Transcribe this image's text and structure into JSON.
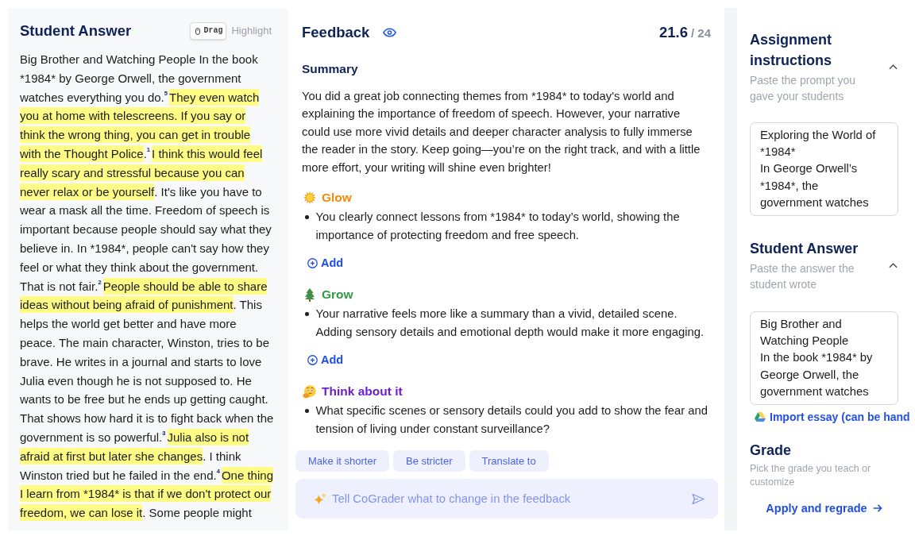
{
  "student_answer": {
    "title": "Student Answer",
    "tools": [
      {
        "label": "Drag",
        "selected": true
      },
      {
        "label": "Highlight",
        "selected": false
      }
    ],
    "segments": [
      {
        "kind": "plain",
        "text": "Big Brother and Watching People In the book *1984* by George Orwell, the government watches everything you do. "
      },
      {
        "kind": "highlight",
        "marker": "5",
        "text": "They even watch you at home with telescreens. If you say or think the wrong thing, you can get in trouble with the Thought Police"
      },
      {
        "kind": "plain",
        "text": ". "
      },
      {
        "kind": "highlight",
        "marker": "1",
        "text": "I think this would feel really scary and stressful because you can never relax or be yourself"
      },
      {
        "kind": "plain",
        "text": ". It's like you have to wear a mask all the time. Freedom of speech is important because people should say what they believe in. In *1984*, people can't say how they feel or what they think about the government. That is not fair. "
      },
      {
        "kind": "highlight",
        "marker": "2",
        "text": "People should be able to share ideas without being afraid of punishment"
      },
      {
        "kind": "plain",
        "text": ". This helps the world get better and have more peace. The main character, Winston, tries to be brave. He writes in a journal and starts to love Julia even though he is not supposed to. He wants to be free but he ends up getting caught. That shows how hard it is to fight back when the government is so powerful. "
      },
      {
        "kind": "highlight",
        "marker": "3",
        "text": "Julia also is not afraid at first but later she changes"
      },
      {
        "kind": "plain",
        "text": ". I think Winston tried but he failed in the end. "
      },
      {
        "kind": "highlight",
        "marker": "4",
        "text": "One thing I learn from *1984* is that if we don't protect our freedom, we can lose it"
      },
      {
        "kind": "plain",
        "text": ". Some people might"
      }
    ]
  },
  "feedback": {
    "title": "Feedback",
    "score": "21.6",
    "max_score": "/ 24",
    "summary": {
      "title": "Summary",
      "text": "You did a great job connecting themes from *1984* to today's world and explaining the importance of freedom of speech. However, your narrative could use more vivid details and deeper character analysis to fully immerse the reader in the story. Keep going—you’re on the right track, and with a little more effort, your writing will shine even brighter!"
    },
    "sections": [
      {
        "kind": "glow",
        "title": "Glow",
        "items": [
          "You clearly connect lessons from *1984* to today’s world, showing the importance of protecting freedom and free speech."
        ],
        "add_label": "Add"
      },
      {
        "kind": "grow",
        "title": "Grow",
        "items": [
          "Your narrative feels more like a summary than a vivid, detailed scene. Adding sensory details and emotional depth would make it more engaging."
        ],
        "add_label": "Add"
      },
      {
        "kind": "think",
        "title": "Think about it",
        "items": [
          "What specific scenes or sensory details could you add to show the fear and tension of living under constant surveillance?"
        ]
      }
    ],
    "suggestions": [
      "Make it shorter",
      "Be stricter",
      "Translate to"
    ],
    "prompt": {
      "placeholder": "Tell CoGrader what to change in the feedback"
    }
  },
  "inputs": [
    {
      "title": "Assignment instructions",
      "hint": "Paste the prompt you gave your students",
      "expanded": true,
      "value": "Exploring the World of *1984*\nIn George Orwell’s *1984*, the government watches"
    },
    {
      "title": "Student Answer",
      "hint": "Paste the answer the student wrote",
      "expanded": true,
      "value": "Big Brother and Watching People\nIn the book *1984* by George Orwell, the government watches",
      "link": "Import essay (can be hand"
    }
  ],
  "grade": {
    "title": "Grade",
    "hint": "Pick the grade you teach or customize",
    "action": "Apply and regrade"
  }
}
